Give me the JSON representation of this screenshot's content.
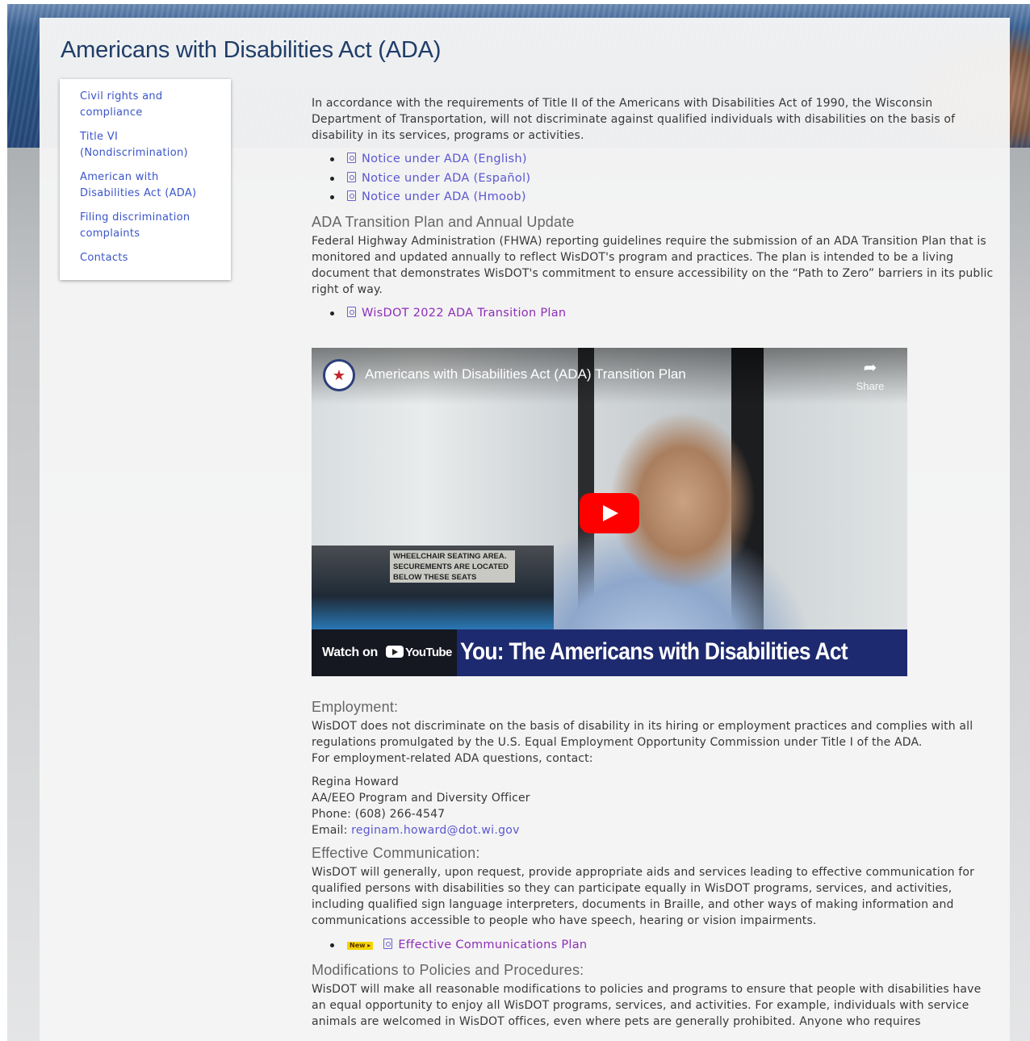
{
  "page": {
    "title": "Americans with Disabilities Act (ADA)"
  },
  "sidebar": {
    "items": [
      {
        "label": "Civil rights and compliance"
      },
      {
        "label": "Title VI (Nondiscrimination)"
      },
      {
        "label": "American with Disabilities Act (ADA)"
      },
      {
        "label": "Filing discrimination complaints"
      },
      {
        "label": "Contacts"
      }
    ]
  },
  "intro": {
    "text": "In accordance with the requirements of Title II of the Americans with Disabilities Act of 1990, the Wisconsin Department of Transportation, will not discriminate against qualified individuals with disabilities on the basis of disability in its services, programs or activities.",
    "notices": [
      {
        "label": "Notice under ADA (English)",
        "icon": "pdf-icon"
      },
      {
        "label": "Notice under ADA (Español)",
        "icon": "pdf-icon"
      },
      {
        "label": "Notice under ADA (Hmoob)",
        "icon": "pdf-icon"
      }
    ]
  },
  "transition": {
    "heading": "ADA Transition Plan and Annual Update",
    "text": "Federal Highway Administration (FHWA) reporting guidelines require the submission of an ADA Transition Plan that is monitored and updated annually to reflect WisDOT's program and practices. The plan is intended to be a living document that demonstrates WisDOT's commitment to ensure accessibility on the “Path to Zero” barriers in its public right of way.",
    "link": {
      "label": "WisDOT 2022 ADA Transition Plan",
      "icon": "pdf-icon"
    }
  },
  "video": {
    "title": "Americans with Disabilities Act (ADA) Transition Plan",
    "share_label": "Share",
    "watch_on_label": "Watch on",
    "youtube_label": "YouTube",
    "banner_text": "You: The Americans with Disabilities Act",
    "sign_text": "WHEELCHAIR SEATING AREA. SECUREMENTS ARE LOCATED BELOW THESE SEATS",
    "play_color": "#ff0000",
    "banner_color": "#1e2a6f"
  },
  "employment": {
    "heading": "Employment:",
    "text": "WisDOT does not discriminate on the basis of disability in its hiring or employment practices and complies with all regulations promulgated by the U.S. Equal Employment Opportunity Commission under Title I of the ADA.",
    "contact_prompt": "For employment-related ADA questions, contact:",
    "contact": {
      "name": "Regina Howard",
      "role": "AA/EEO Program and Diversity Officer",
      "phone": "Phone: (608) 266-4547",
      "email_label": "Email:",
      "email": "reginam.howard@dot.wi.gov"
    }
  },
  "communication": {
    "heading": "Effective Communication:",
    "text": "WisDOT will generally, upon request, provide appropriate aids and services leading to effective communication for qualified persons with disabilities so they can participate equally in WisDOT programs, services, and activities, including qualified sign language interpreters, documents in Braille, and other ways of making information and communications accessible to people who have speech, hearing or vision impairments.",
    "badge": "New ▸",
    "link": {
      "label": "Effective Communications Plan",
      "icon": "pdf-icon"
    }
  },
  "modifications": {
    "heading": "Modifications to Policies and Procedures:",
    "text": "WisDOT will make all reasonable modifications to policies and programs to ensure that people with disabilities have an equal opportunity to enjoy all WisDOT programs, services, and activities. For example, individuals with service animals are welcomed in WisDOT offices, even where pets are generally prohibited. Anyone who requires"
  },
  "colors": {
    "title": "#1f3d68",
    "link": "#5b57d1",
    "visited_link": "#8e2db8",
    "nav_link": "#3b55c9"
  }
}
